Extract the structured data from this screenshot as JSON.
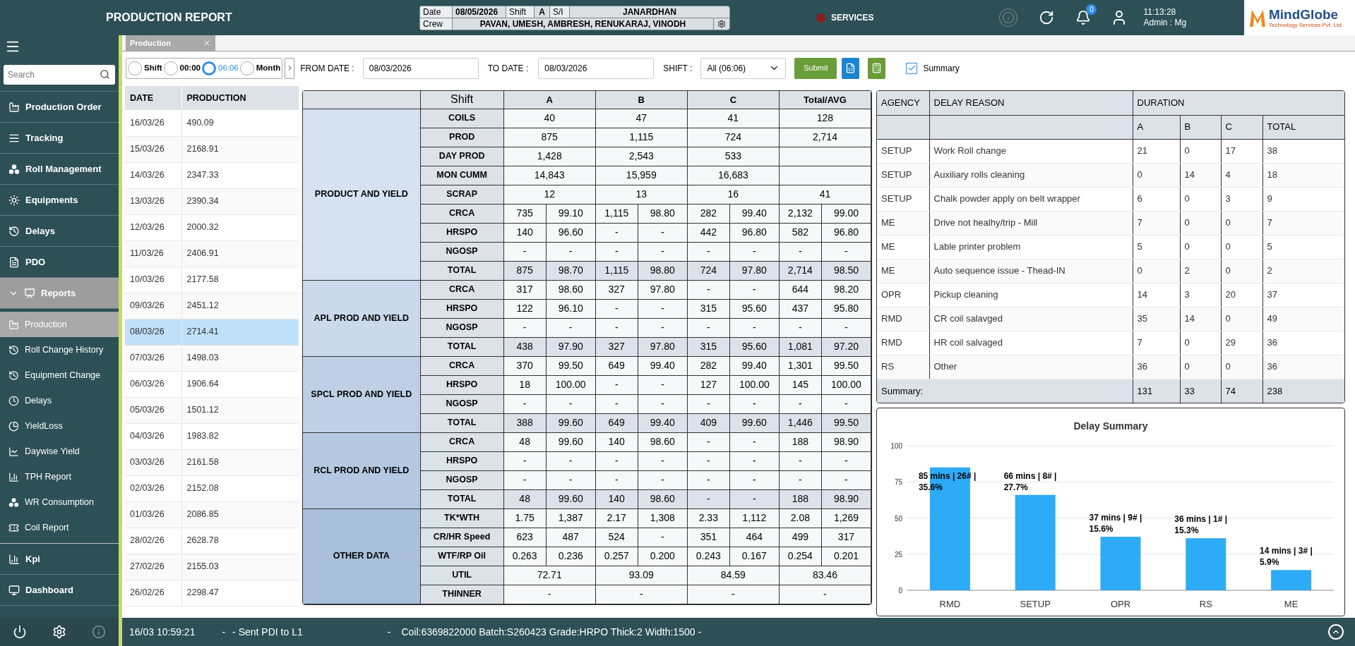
{
  "header": {
    "title": "PRODUCTION REPORT",
    "shift_info": {
      "date_label": "Date",
      "date": "08/05/2026",
      "shift_label": "Shift",
      "shift": "A",
      "si_label": "S/I",
      "si": "JANARDHAN",
      "crew_label": "Crew",
      "crew": "PAVAN, UMESH, AMBRESH, RENUKARAJ, VINODH"
    },
    "services": "SERVICES",
    "notifications": "0",
    "clock": "11:13:28",
    "user": "Admin : Mg",
    "logo": {
      "name": "MindGlobe",
      "tagline": "Technology Services Pvt. Ltd."
    }
  },
  "sidebar": {
    "search": {
      "placeholder": "Search"
    },
    "items": [
      {
        "label": "Production Order",
        "selected": false
      },
      {
        "label": "Tracking",
        "selected": false
      },
      {
        "label": "Roll Management",
        "selected": false
      },
      {
        "label": "Equipments",
        "selected": false
      },
      {
        "label": "Delays",
        "selected": false
      },
      {
        "label": "PDO",
        "selected": false
      },
      {
        "label": "Reports",
        "selected": false,
        "expanded": true,
        "children": [
          {
            "label": "Production",
            "selected": true
          },
          {
            "label": "Roll Change History",
            "selected": false
          },
          {
            "label": "Equipment Change",
            "selected": false
          },
          {
            "label": "Delays",
            "selected": false
          },
          {
            "label": "YieldLoss",
            "selected": false
          },
          {
            "label": "Daywise Yield",
            "selected": false
          },
          {
            "label": "TPH Report",
            "selected": false
          },
          {
            "label": "WR Consumption",
            "selected": false
          },
          {
            "label": "Coil Report",
            "selected": false
          }
        ]
      },
      {
        "label": "Kpi",
        "selected": false
      },
      {
        "label": "Dashboard",
        "selected": false
      }
    ]
  },
  "tabs": [
    {
      "label": "Production",
      "selected": true
    }
  ],
  "toolbar": {
    "modes": [
      {
        "label": "Shift",
        "selected": false
      },
      {
        "label": "00:00",
        "selected": false
      },
      {
        "label": "06:06",
        "selected": true
      },
      {
        "label": "Month",
        "selected": false
      }
    ],
    "from_date": {
      "label": "FROM DATE :",
      "value": "08/03/2026"
    },
    "to_date": {
      "label": "TO DATE :",
      "value": "08/03/2026"
    },
    "shift": {
      "label": "SHIFT :",
      "value": "All (06:06)"
    },
    "submit": "Submit",
    "summary": {
      "label": "Summary",
      "checked": true
    }
  },
  "date_list": {
    "columns": [
      "DATE",
      "PRODUCTION"
    ],
    "rows": [
      {
        "date": "16/03/26",
        "production": "490.09",
        "selected": false
      },
      {
        "date": "15/03/26",
        "production": "2168.91",
        "selected": false
      },
      {
        "date": "14/03/26",
        "production": "2347.33",
        "selected": false
      },
      {
        "date": "13/03/26",
        "production": "2390.34",
        "selected": false
      },
      {
        "date": "12/03/26",
        "production": "2000.32",
        "selected": false
      },
      {
        "date": "11/03/26",
        "production": "2406.91",
        "selected": false
      },
      {
        "date": "10/03/26",
        "production": "2177.58",
        "selected": false
      },
      {
        "date": "09/03/26",
        "production": "2451.12",
        "selected": false
      },
      {
        "date": "08/03/26",
        "production": "2714.41",
        "selected": true
      },
      {
        "date": "07/03/26",
        "production": "1498.03",
        "selected": false
      },
      {
        "date": "06/03/26",
        "production": "1906.64",
        "selected": false
      },
      {
        "date": "05/03/26",
        "production": "1501.12",
        "selected": false
      },
      {
        "date": "04/03/26",
        "production": "1983.82",
        "selected": false
      },
      {
        "date": "03/03/26",
        "production": "2161.58",
        "selected": false
      },
      {
        "date": "02/03/26",
        "production": "2152.08",
        "selected": false
      },
      {
        "date": "01/03/26",
        "production": "2086.85",
        "selected": false
      },
      {
        "date": "28/02/26",
        "production": "2628.78",
        "selected": false
      },
      {
        "date": "27/02/26",
        "production": "2155.03",
        "selected": false
      },
      {
        "date": "26/02/26",
        "production": "2298.47",
        "selected": false
      }
    ]
  },
  "report": {
    "columns": [
      "Shift",
      "A",
      "B",
      "C",
      "Total/AVG"
    ],
    "sections": [
      {
        "title": "PRODUCT AND YIELD",
        "rows": [
          {
            "label": "COILS",
            "kind": "single",
            "values": [
              "40",
              "47",
              "41",
              "128"
            ]
          },
          {
            "label": "PROD",
            "kind": "single",
            "values": [
              "875",
              "1,115",
              "724",
              "2,714"
            ]
          },
          {
            "label": "DAY PROD",
            "kind": "single",
            "values": [
              "1,428",
              "2,543",
              "533"
            ]
          },
          {
            "label": "MON CUMM",
            "kind": "single",
            "values": [
              "14,843",
              "15,959",
              "16,683"
            ]
          },
          {
            "label": "SCRAP",
            "kind": "single",
            "values": [
              "12",
              "13",
              "16",
              "41"
            ]
          },
          {
            "label": "CRCA",
            "kind": "pair",
            "values": [
              "735",
              "99.10",
              "1,115",
              "98.80",
              "282",
              "99.40",
              "2,132",
              "99.00"
            ]
          },
          {
            "label": "HRSPO",
            "kind": "pair",
            "values": [
              "140",
              "96.60",
              "-",
              "-",
              "442",
              "96.80",
              "582",
              "96.80"
            ]
          },
          {
            "label": "NGOSP",
            "kind": "pair",
            "values": [
              "-",
              "-",
              "-",
              "-",
              "-",
              "-",
              "-",
              "-"
            ]
          },
          {
            "label": "TOTAL",
            "kind": "total",
            "values": [
              "875",
              "98.70",
              "1,115",
              "98.80",
              "724",
              "97.80",
              "2,714",
              "98.50"
            ]
          }
        ]
      },
      {
        "title": "APL PROD AND YIELD",
        "rows": [
          {
            "label": "CRCA",
            "kind": "pair",
            "values": [
              "317",
              "98.60",
              "327",
              "97.80",
              "-",
              "-",
              "644",
              "98.20"
            ]
          },
          {
            "label": "HRSPO",
            "kind": "pair",
            "values": [
              "122",
              "96.10",
              "-",
              "-",
              "315",
              "95.60",
              "437",
              "95.80"
            ]
          },
          {
            "label": "NGOSP",
            "kind": "pair",
            "values": [
              "-",
              "-",
              "-",
              "-",
              "-",
              "-",
              "-",
              "-"
            ]
          },
          {
            "label": "TOTAL",
            "kind": "total",
            "values": [
              "438",
              "97.90",
              "327",
              "97.80",
              "315",
              "95.60",
              "1,081",
              "97.20"
            ]
          }
        ]
      },
      {
        "title": "SPCL PROD AND YIELD",
        "rows": [
          {
            "label": "CRCA",
            "kind": "pair",
            "values": [
              "370",
              "99.50",
              "649",
              "99.40",
              "282",
              "99.40",
              "1,301",
              "99.50"
            ]
          },
          {
            "label": "HRSPO",
            "kind": "pair",
            "values": [
              "18",
              "100.00",
              "-",
              "-",
              "127",
              "100.00",
              "145",
              "100.00"
            ]
          },
          {
            "label": "NGOSP",
            "kind": "pair",
            "values": [
              "-",
              "-",
              "-",
              "-",
              "-",
              "-",
              "-",
              "-"
            ]
          },
          {
            "label": "TOTAL",
            "kind": "total",
            "values": [
              "388",
              "99.60",
              "649",
              "99.40",
              "409",
              "99.60",
              "1,446",
              "99.50"
            ]
          }
        ]
      },
      {
        "title": "RCL PROD AND YIELD",
        "rows": [
          {
            "label": "CRCA",
            "kind": "pair",
            "values": [
              "48",
              "99.60",
              "140",
              "98.60",
              "-",
              "-",
              "188",
              "98.90"
            ]
          },
          {
            "label": "HRSPO",
            "kind": "pair",
            "values": [
              "-",
              "-",
              "-",
              "-",
              "-",
              "-",
              "-",
              "-"
            ]
          },
          {
            "label": "NGOSP",
            "kind": "pair",
            "values": [
              "-",
              "-",
              "-",
              "-",
              "-",
              "-",
              "-",
              "-"
            ]
          },
          {
            "label": "TOTAL",
            "kind": "total",
            "values": [
              "48",
              "99.60",
              "140",
              "98.60",
              "-",
              "-",
              "188",
              "98.90"
            ]
          }
        ]
      },
      {
        "title": "OTHER DATA",
        "rows": [
          {
            "label": "TK*WTH",
            "kind": "pair",
            "values": [
              "1.75",
              "1,387",
              "2.17",
              "1,308",
              "2.33",
              "1,112",
              "2.08",
              "1,269"
            ]
          },
          {
            "label": "CR/HR Speed",
            "kind": "pair",
            "values": [
              "623",
              "487",
              "524",
              "-",
              "351",
              "464",
              "499",
              "317"
            ]
          },
          {
            "label": "WTF/RP Oil",
            "kind": "pair",
            "values": [
              "0.263",
              "0.236",
              "0.257",
              "0.200",
              "0.243",
              "0.167",
              "0.254",
              "0.201"
            ]
          },
          {
            "label": "UTIL",
            "kind": "single",
            "values": [
              "72.71",
              "93.09",
              "84.59",
              "83.46"
            ]
          },
          {
            "label": "THINNER",
            "kind": "single",
            "values": [
              "-",
              "-",
              "-",
              "-"
            ]
          }
        ]
      }
    ]
  },
  "delays": {
    "columns": [
      "AGENCY",
      "DELAY REASON",
      "DURATION"
    ],
    "sub_columns": [
      "A",
      "B",
      "C",
      "TOTAL"
    ],
    "rows": [
      {
        "agency": "SETUP",
        "reason": "Work Roll change",
        "values": [
          "21",
          "0",
          "17",
          "38"
        ]
      },
      {
        "agency": "SETUP",
        "reason": "Auxiliary rolls cleaning",
        "values": [
          "0",
          "14",
          "4",
          "18"
        ]
      },
      {
        "agency": "SETUP",
        "reason": "Chalk powder apply on belt wrapper",
        "values": [
          "6",
          "0",
          "3",
          "9"
        ]
      },
      {
        "agency": "ME",
        "reason": "Drive not healhy/trip - Mill",
        "values": [
          "7",
          "0",
          "0",
          "7"
        ]
      },
      {
        "agency": "ME",
        "reason": "Lable printer problem",
        "values": [
          "5",
          "0",
          "0",
          "5"
        ]
      },
      {
        "agency": "ME",
        "reason": "Auto sequence issue - Thead-IN",
        "values": [
          "0",
          "2",
          "0",
          "2"
        ]
      },
      {
        "agency": "OPR",
        "reason": "Pickup cleaning",
        "values": [
          "14",
          "3",
          "20",
          "37"
        ]
      },
      {
        "agency": "RMD",
        "reason": "CR coil salavged",
        "values": [
          "35",
          "14",
          "0",
          "49"
        ]
      },
      {
        "agency": "RMD",
        "reason": "HR coil salvaged",
        "values": [
          "7",
          "0",
          "29",
          "36"
        ]
      },
      {
        "agency": "RS",
        "reason": "Other",
        "values": [
          "36",
          "0",
          "0",
          "36"
        ]
      }
    ],
    "summary": {
      "label": "Summary:",
      "values": [
        "131",
        "33",
        "74",
        "238"
      ]
    },
    "chart_data": {
      "type": "bar",
      "title": "Delay Summary",
      "categories": [
        "RMD",
        "SETUP",
        "OPR",
        "RS",
        "ME"
      ],
      "series": [
        {
          "color": "#2eabf7",
          "values": [
            85,
            66,
            37,
            36,
            14
          ]
        }
      ],
      "ylim": [
        0,
        100
      ],
      "yticks": [
        0,
        25,
        50,
        75,
        100
      ],
      "grid": true,
      "value_labels": [
        "85 mins | 26# | 35.6%",
        "66 mins | 8# | 27.7%",
        "37 mins | 9# | 15.6%",
        "36 mins | 1# | 15.3%",
        "14 mins | 3# | 5.9%"
      ]
    }
  },
  "status_bar": {
    "time": "16/03 10:59:21",
    "items": [
      "-",
      "- Sent PDI to L1",
      "-",
      "Coil:6369822000 Batch:S260423 Grade:HRPO Thick:2 Width:1500 -"
    ]
  }
}
